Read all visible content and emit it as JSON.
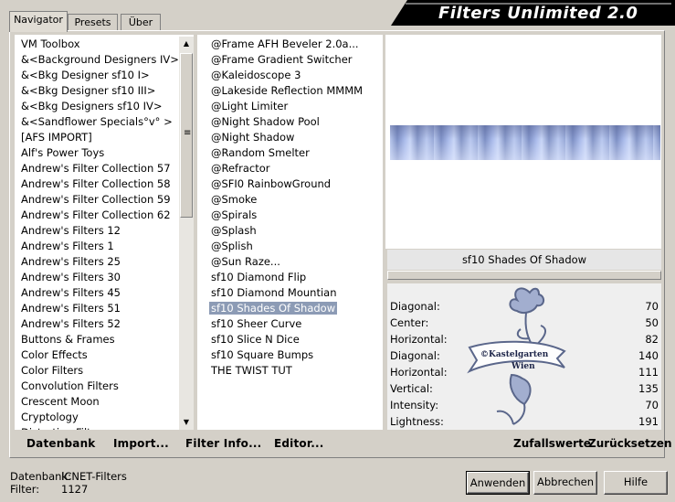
{
  "tabs": [
    "Navigator",
    "Presets",
    "Über"
  ],
  "banner_title": "Filters Unlimited 2.0",
  "categories": [
    "VM Toolbox",
    "&<Background Designers IV>",
    "&<Bkg Designer sf10 I>",
    "&<Bkg Designer sf10 III>",
    "&<Bkg Designers sf10 IV>",
    "&<Sandflower Specials°v° >",
    "[AFS IMPORT]",
    "Alf's Power Toys",
    "Andrew's Filter Collection 57",
    "Andrew's Filter Collection 58",
    "Andrew's Filter Collection 59",
    "Andrew's Filter Collection 62",
    "Andrew's Filters 12",
    "Andrew's Filters 1",
    "Andrew's Filters 25",
    "Andrew's Filters 30",
    "Andrew's Filters 45",
    "Andrew's Filters 51",
    "Andrew's Filters 52",
    "Buttons & Frames",
    "Color Effects",
    "Color Filters",
    "Convolution Filters",
    "Crescent Moon",
    "Cryptology",
    "Distortion Filters"
  ],
  "filters": [
    "@Frame AFH Beveler 2.0a...",
    "@Frame Gradient Switcher",
    "@Kaleidoscope 3",
    "@Lakeside Reflection MMMM",
    "@Light Limiter",
    "@Night Shadow Pool",
    "@Night Shadow",
    "@Random Smelter",
    "@Refractor",
    "@SFI0 RainbowGround",
    "@Smoke",
    "@Spirals",
    "@Splash",
    "@Splish",
    "@Sun Raze...",
    "sf10 Diamond Flip",
    "sf10 Diamond Mountian",
    "sf10 Shades Of Shadow",
    "sf10 Sheer Curve",
    "sf10 Slice N Dice",
    "sf10 Square Bumps",
    "THE TWIST TUT"
  ],
  "selected_filter": "sf10 Shades Of Shadow",
  "toolbar": {
    "database": "Datenbank",
    "import": "Import...",
    "filter_info": "Filter Info...",
    "editor": "Editor..."
  },
  "params": [
    {
      "name": "Diagonal:",
      "value": "70"
    },
    {
      "name": "Center:",
      "value": "50"
    },
    {
      "name": "Horizontal:",
      "value": "82"
    },
    {
      "name": "Diagonal:",
      "value": "140"
    },
    {
      "name": "Horizontal:",
      "value": "111"
    },
    {
      "name": "Vertical:",
      "value": "135"
    },
    {
      "name": "Intensity:",
      "value": "70"
    },
    {
      "name": "Lightness:",
      "value": "191"
    }
  ],
  "watermark_text": [
    "©Kastelgarten",
    "Wien"
  ],
  "random_label": "Zufallswerte",
  "reset_label": "Zurücksetzen",
  "status": {
    "db_label": "Datenbank:",
    "db_value": "ICNET-Filters",
    "filter_label": "Filter:",
    "filter_value": "1127"
  },
  "buttons": {
    "apply": "Anwenden",
    "cancel": "Abbrechen",
    "help": "Hilfe"
  },
  "colors": {
    "dialog_bg": "#d4d0c8",
    "selection": "#8c9bb5",
    "banner": "#000000",
    "watermark": "#4a5880"
  },
  "icons": {
    "scroll_up": "▲",
    "scroll_down": "▼",
    "scroll_grip": "≡"
  }
}
